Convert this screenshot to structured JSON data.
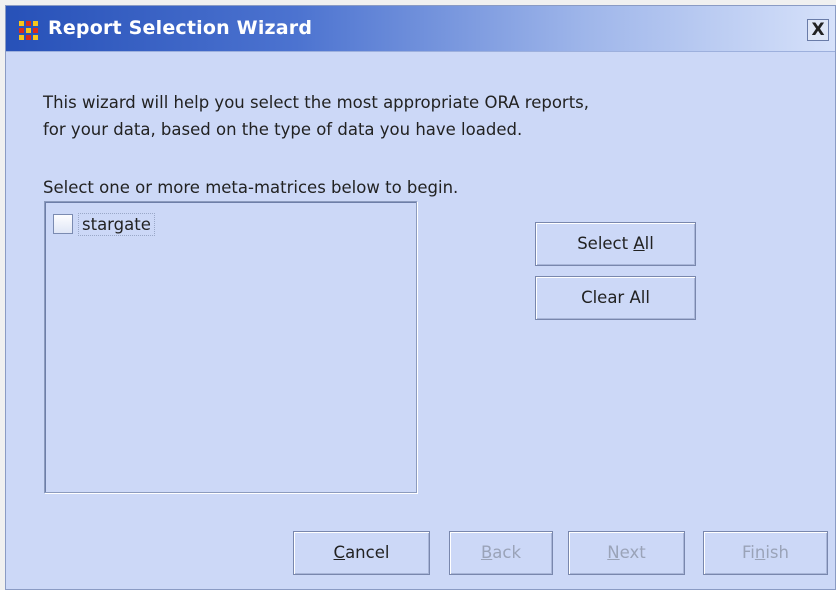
{
  "window": {
    "title": "Report Selection Wizard",
    "close_label": "X"
  },
  "intro": {
    "line1": "This wizard will help you select the most appropriate ORA reports,",
    "line2": "for your data, based on the type of data you have loaded."
  },
  "list": {
    "label": "Select one or more meta-matrices below to begin.",
    "items": [
      {
        "label": "stargate",
        "checked": false
      }
    ]
  },
  "buttons": {
    "select_all": {
      "pre": "Select ",
      "mnemonic": "A",
      "post": "ll"
    },
    "clear_all": {
      "label": "Clear All"
    },
    "cancel": {
      "pre": "",
      "mnemonic": "C",
      "post": "ancel",
      "enabled": true
    },
    "back": {
      "pre": "",
      "mnemonic": "B",
      "post": "ack",
      "enabled": false
    },
    "next": {
      "pre": "",
      "mnemonic": "N",
      "post": "ext",
      "enabled": false
    },
    "finish": {
      "pre": "Fi",
      "mnemonic": "n",
      "post": "ish",
      "enabled": false
    }
  },
  "colors": {
    "dialog_bg": "#ccd8f7",
    "titlebar_start": "#2751b8",
    "titlebar_end": "#d6e1fa",
    "icon_yellow": "#f7c51b",
    "icon_red": "#d92b1e"
  }
}
